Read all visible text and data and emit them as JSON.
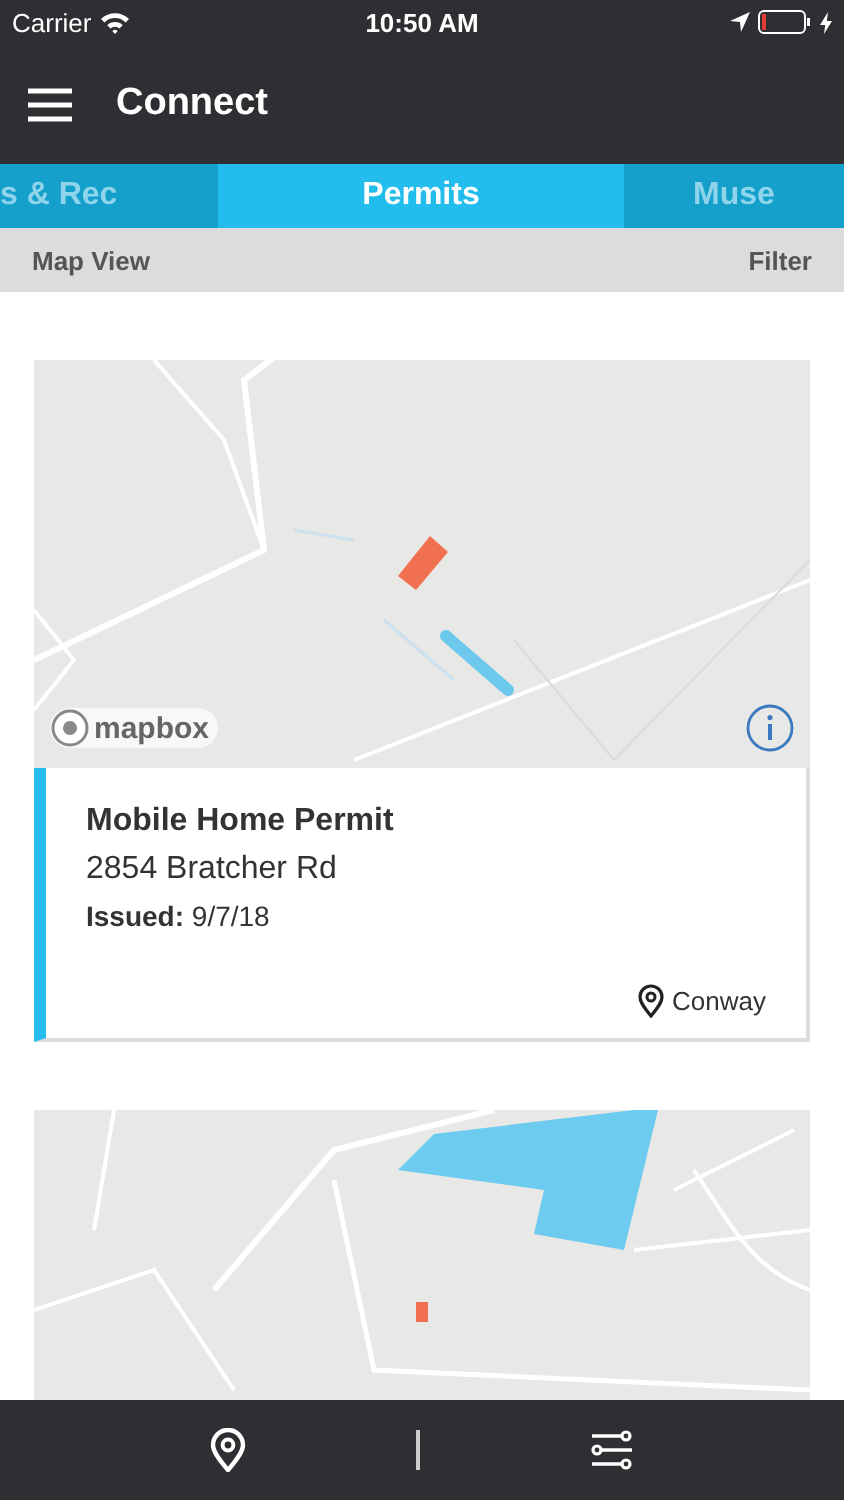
{
  "status_bar": {
    "carrier": "Carrier",
    "time": "10:50 AM"
  },
  "header": {
    "title": "Connect"
  },
  "tabs": [
    {
      "label": "s & Rec",
      "selected": false
    },
    {
      "label": "Permits",
      "selected": true
    },
    {
      "label": "Muse",
      "selected": false
    }
  ],
  "toolbar": {
    "left": "Map View",
    "right": "Filter"
  },
  "permits": [
    {
      "map": {
        "kind": "picture",
        "attribution": "mapbox"
      },
      "title": "Mobile Home Permit",
      "address": "2854 Bratcher Rd",
      "issued": "**Issued:** 9/7/18",
      "location": "Conway"
    },
    {
      "map": {
        "kind": "picture"
      }
    }
  ]
}
